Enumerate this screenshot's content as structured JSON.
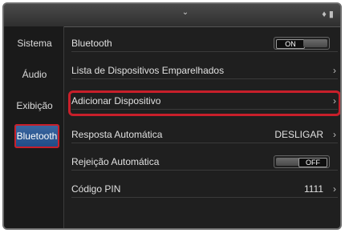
{
  "header": {
    "chevron": "⌄",
    "status": "♦ ▮"
  },
  "left_menu": [
    {
      "label": "Sistema"
    },
    {
      "label": "Áudio"
    },
    {
      "label": "Exibição"
    },
    {
      "label": "Bluetooth",
      "active": true
    }
  ],
  "settings": [
    {
      "label": "Bluetooth",
      "type": "toggle",
      "state": "ON"
    },
    {
      "label": "Lista de Dispositivos Emparelhados",
      "type": "arrow",
      "value": ""
    },
    {
      "label": "Adicionar Dispositivo",
      "type": "arrow",
      "value": ""
    },
    {
      "label": "Resposta Automática",
      "type": "arrow",
      "value": "DESLIGAR"
    },
    {
      "label": "Rejeição Automática",
      "type": "toggle",
      "state": "OFF"
    },
    {
      "label": "Código PIN",
      "type": "arrow",
      "value": "1111"
    }
  ],
  "colors": {
    "highlight": "#c81f2a",
    "active_bg": "#2f5d98"
  }
}
